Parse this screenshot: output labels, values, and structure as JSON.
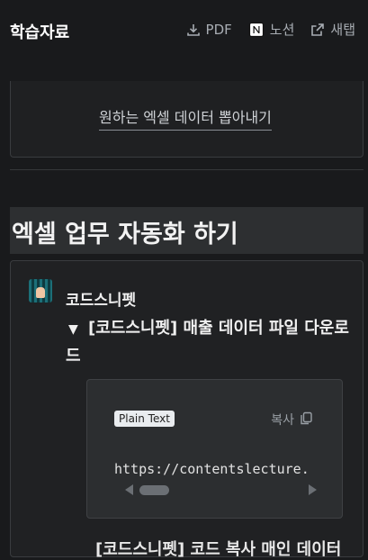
{
  "header": {
    "title": "학습자료",
    "actions": [
      {
        "label": "PDF",
        "icon": "download-icon"
      },
      {
        "label": "노션",
        "icon": "notion-icon"
      },
      {
        "label": "새탭",
        "icon": "external-link-icon"
      }
    ]
  },
  "previous_section": {
    "link_text": "원하는 엑셀 데이터 뽑아내기"
  },
  "section": {
    "heading": "엑셀 업무 자동화 하기"
  },
  "snippet_card": {
    "author": "코드스니펫",
    "toggle_arrow": "▼",
    "toggle_title": "[코드스니펫] 매출 데이터 파일 다운로드",
    "code": {
      "language": "Plain Text",
      "copy_label": "복사",
      "text": "https://contentslecture."
    },
    "next_toggle_partial": "[코드스니펫] 코드 복사 매인 데이터"
  }
}
